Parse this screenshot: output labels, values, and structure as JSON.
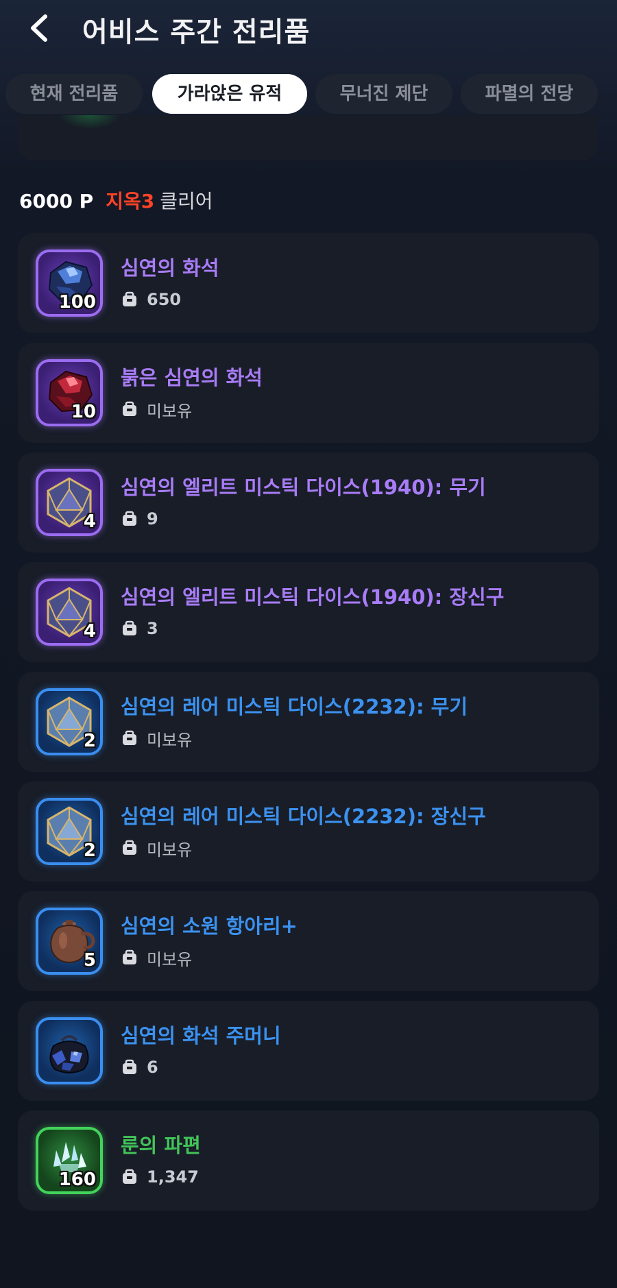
{
  "header": {
    "title": "어비스 주간 전리품"
  },
  "tabs": [
    {
      "label": "현재 전리품",
      "active": false
    },
    {
      "label": "가라앉은 유적",
      "active": true
    },
    {
      "label": "무너진 제단",
      "active": false
    },
    {
      "label": "파멸의 전당",
      "active": false
    }
  ],
  "section": {
    "points": "6000 P",
    "level": "지옥3",
    "suffix": "클리어"
  },
  "items": [
    {
      "name": "심연의 화석",
      "qty": "100",
      "owned": "650",
      "grade": "epic",
      "icon": "dark-blue-fossil-stone"
    },
    {
      "name": "붉은 심연의 화석",
      "qty": "10",
      "owned": "미보유",
      "grade": "epic",
      "icon": "red-fossil-stone"
    },
    {
      "name": "심연의 엘리트 미스틱 다이스(1940): 무기",
      "qty": "4",
      "owned": "9",
      "grade": "epic",
      "icon": "mystic-dice"
    },
    {
      "name": "심연의 엘리트 미스틱 다이스(1940): 장신구",
      "qty": "4",
      "owned": "3",
      "grade": "epic",
      "icon": "mystic-dice"
    },
    {
      "name": "심연의 레어 미스틱 다이스(2232): 무기",
      "qty": "2",
      "owned": "미보유",
      "grade": "rare",
      "icon": "mystic-dice"
    },
    {
      "name": "심연의 레어 미스틱 다이스(2232): 장신구",
      "qty": "2",
      "owned": "미보유",
      "grade": "rare",
      "icon": "mystic-dice"
    },
    {
      "name": "심연의 소원 항아리+",
      "qty": "5",
      "owned": "미보유",
      "grade": "rare",
      "icon": "clay-wish-pot"
    },
    {
      "name": "심연의 화석 주머니",
      "qty": "",
      "owned": "6",
      "grade": "rare",
      "icon": "fossil-pouch"
    },
    {
      "name": "룬의 파편",
      "qty": "160",
      "owned": "1,347",
      "grade": "uncommon",
      "icon": "rune-crystal-shards"
    }
  ],
  "colors": {
    "epic": "#a97cf7",
    "rare": "#3b92f0",
    "uncommon": "#42c458",
    "level_red": "#ff4326",
    "card_bg": "#181d28",
    "active_tab_bg": "#ffffff"
  }
}
